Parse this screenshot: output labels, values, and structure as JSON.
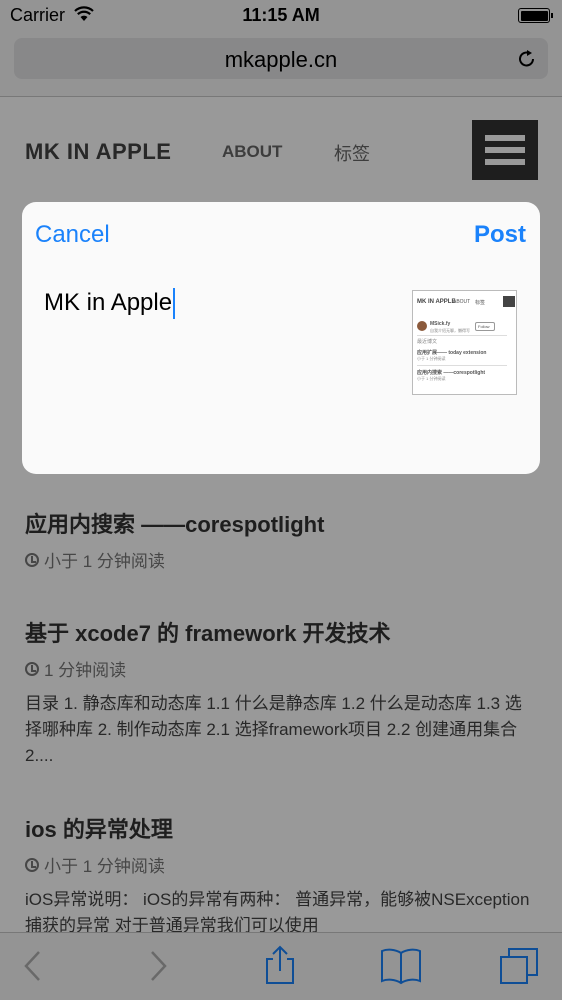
{
  "status_bar": {
    "carrier": "Carrier",
    "time": "11:15 AM",
    "battery_level": 1.0
  },
  "address_bar": {
    "domain": "mkapple.cn",
    "reload_icon": "reload-icon"
  },
  "site_header": {
    "title": "MK IN APPLE",
    "nav": [
      "ABOUT",
      "标签"
    ],
    "menu_icon": "hamburger-icon"
  },
  "posts": [
    {
      "title": "应用内搜索 ——corespotlight",
      "read_time": "小于 1 分钟阅读",
      "excerpt": ""
    },
    {
      "title": "基于 xcode7 的 framework 开发技术",
      "read_time": "1 分钟阅读",
      "excerpt": "目录 1. 静态库和动态库 1.1 什么是静态库 1.2 什么是动态库 1.3 选择哪种库 2. 制作动态库 2.1 选择framework项目 2.2 创建通用集合 2...."
    },
    {
      "title": "ios 的异常处理",
      "read_time": "小于 1 分钟阅读",
      "excerpt": "iOS异常说明： iOS的异常有两种： 普通异常，能够被NSException捕获的异常 对于普通异常我们可以使用"
    }
  ],
  "toolbar": {
    "icons": [
      "back-icon",
      "forward-icon",
      "share-icon",
      "bookmarks-icon",
      "tabs-icon"
    ]
  },
  "share_sheet": {
    "cancel_label": "Cancel",
    "post_label": "Post",
    "compose_text": "MK in Apple",
    "thumbnail": {
      "title": "MK IN APPLE",
      "nav_about": "ABOUT",
      "nav_tags": "标签",
      "author": "MSick.fy",
      "author_desc": "自我介绍无聊，懒得写",
      "follow": "Follow",
      "section": "最近博文",
      "post1": "应用扩展—— today extension",
      "post1_time": "小于 1 分钟阅读",
      "post2": "应用内搜索 ——corespotlight",
      "post2_time": "小于 1 分钟阅读"
    }
  },
  "colors": {
    "accent": "#1a82fb",
    "overlay": "rgba(0,0,0,0.4)"
  }
}
